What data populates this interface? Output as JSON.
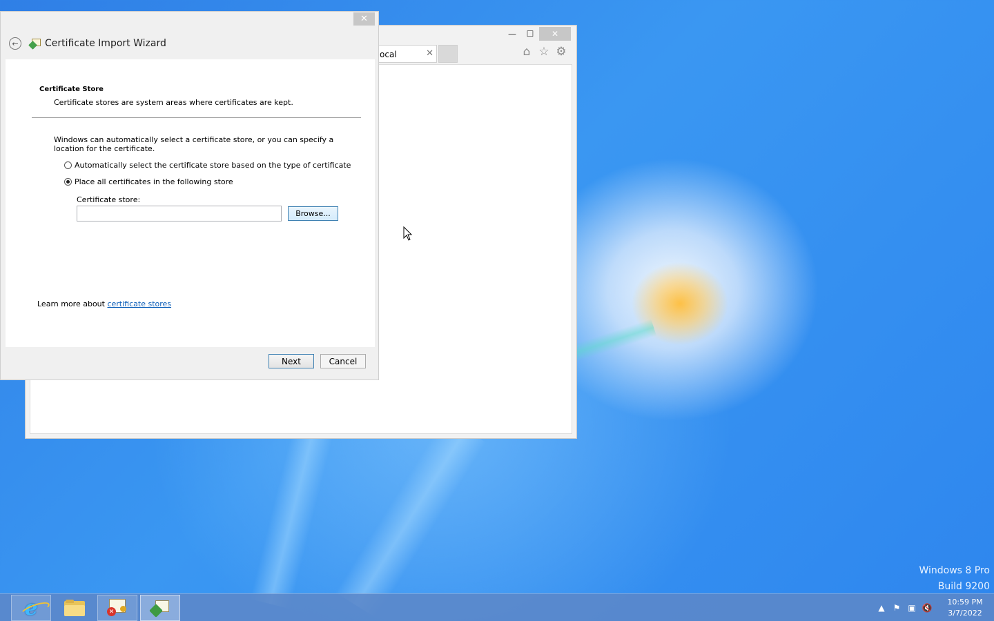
{
  "wizard": {
    "title": "Certificate Import Wizard",
    "close_label": "✕",
    "section_title": "Certificate Store",
    "section_desc": "Certificate stores are system areas where certificates are kept.",
    "intro": "Windows can automatically select a certificate store, or you can specify a location for the certificate.",
    "option_auto": "Automatically select the certificate store based on the type of certificate",
    "option_place": "Place all certificates in the following store",
    "selected_option": "place",
    "store_label": "Certificate store:",
    "store_value": "",
    "browse_label": "Browse...",
    "learn_prefix": "Learn more about ",
    "learn_link": "certificate stores",
    "next_label": "Next",
    "cancel_label": "Cancel"
  },
  "ie": {
    "tab_label": "ocal",
    "tab_close": "✕",
    "minimize": "—",
    "maximize": "☐",
    "close": "✕",
    "icons": [
      "home-icon",
      "favorites-star-icon",
      "tools-gear-icon"
    ]
  },
  "watermark": {
    "line1": "Windows 8 Pro",
    "line2": "Build 9200"
  },
  "taskbar": {
    "buttons": [
      "internet-explorer-icon",
      "file-explorer-icon",
      "certificate-error-icon",
      "certificate-import-wizard-icon"
    ],
    "tray_icons": [
      "show-hidden-icons-arrow",
      "action-center-flag-icon",
      "network-icon",
      "volume-muted-icon"
    ],
    "time": "10:59 PM",
    "date": "3/7/2022"
  },
  "colors": {
    "link": "#0a5db8",
    "close_button": "#c7c7c7",
    "desktop_blue": "#2f7fe6"
  }
}
